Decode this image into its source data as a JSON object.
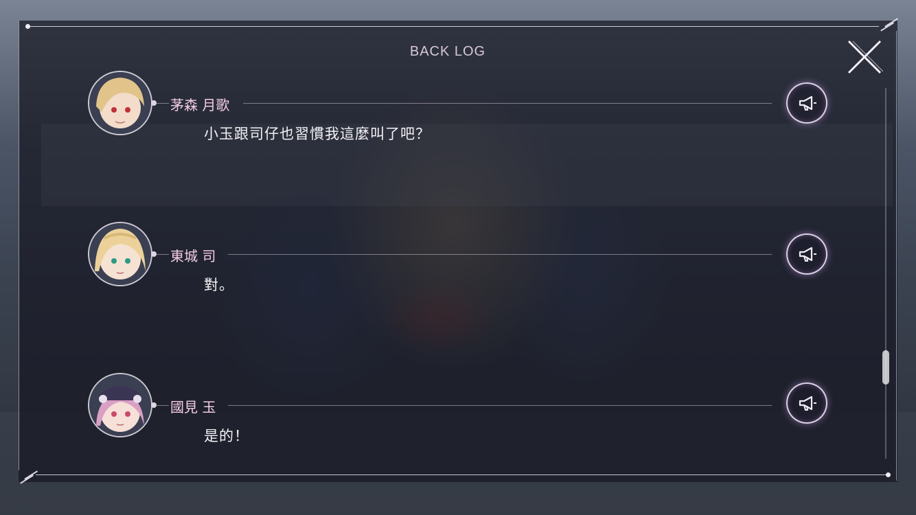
{
  "backlog": {
    "title": "BACK LOG",
    "entries": [
      {
        "speaker": "茅森 月歌",
        "text": "小玉跟司仔也習慣我這麼叫了吧？",
        "avatar_icon": "character-portrait-blonde-red-eyes"
      },
      {
        "speaker": "東城 司",
        "text": "對。",
        "avatar_icon": "character-portrait-blonde-green-eyes"
      },
      {
        "speaker": "國見 玉",
        "text": "是的！",
        "avatar_icon": "character-portrait-pink-hair-cap"
      }
    ],
    "voice_icon": "megaphone-icon",
    "close_icon": "close-icon"
  },
  "colors": {
    "speaker_name": "#f4cde4",
    "dialogue_text": "#f3f1f5",
    "panel_bg": "#16182299",
    "accent_glow": "#c896e6"
  }
}
